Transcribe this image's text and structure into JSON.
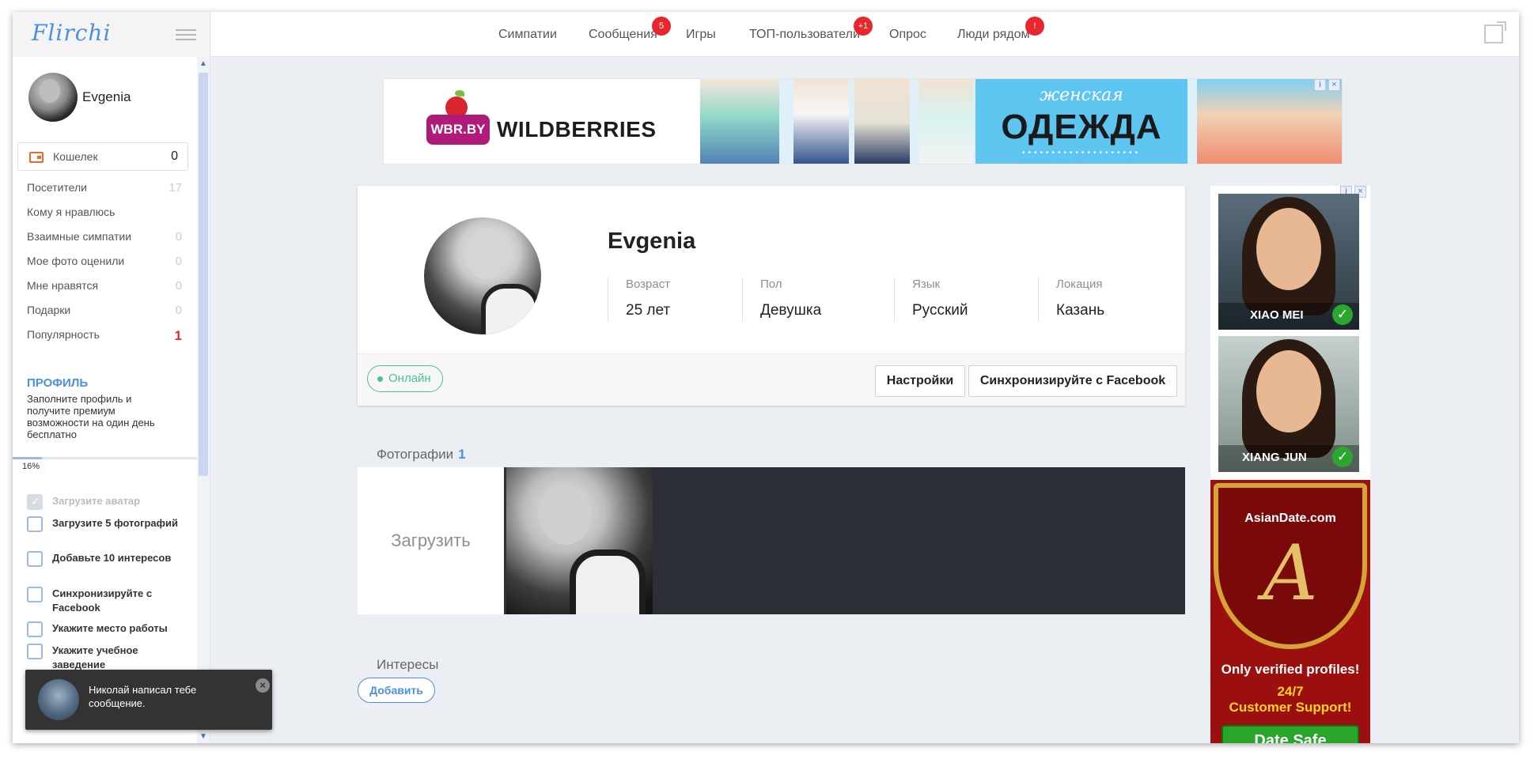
{
  "app": {
    "logo": "Flirchi"
  },
  "nav": {
    "items": [
      {
        "label": "Симпатии",
        "badge": ""
      },
      {
        "label": "Сообщения",
        "badge": "5"
      },
      {
        "label": "Игры",
        "badge": ""
      },
      {
        "label": "ТОП-пользователи",
        "badge": "+1"
      },
      {
        "label": "Опрос",
        "badge": ""
      },
      {
        "label": "Люди рядом",
        "badge": "!"
      }
    ]
  },
  "sidebar": {
    "user_name": "Evgenia",
    "wallet": {
      "label": "Кошелек",
      "value": "0"
    },
    "menu": [
      {
        "label": "Посетители",
        "count": "17"
      },
      {
        "label": "Кому я нравлюсь",
        "count": ""
      },
      {
        "label": "Взаимные симпатии",
        "count": "0"
      },
      {
        "label": "Мое фото оценили",
        "count": "0"
      },
      {
        "label": "Мне нравятся",
        "count": "0"
      },
      {
        "label": "Подарки",
        "count": "0"
      },
      {
        "label": "Популярность",
        "count": "1"
      }
    ],
    "profile": {
      "heading": "ПРОФИЛЬ",
      "description": "Заполните профиль и получите премиум возможности на один день бесплатно",
      "progress_percent": 16,
      "progress_text": "16%"
    },
    "tasks": [
      {
        "label": "Загрузите аватар",
        "done": true
      },
      {
        "label": "Загрузите 5 фотографий",
        "done": false
      },
      {
        "label": "Добавьте 10 интересов",
        "done": false
      },
      {
        "label": "Синхронизируйте с Facebook",
        "done": false
      },
      {
        "label": "Укажите место работы",
        "done": false
      },
      {
        "label": "Укажите учебное заведение",
        "done": false
      }
    ]
  },
  "notification": {
    "text": "Николай написал тебе сообщение."
  },
  "ad_top": {
    "logo_text": "WBR.BY",
    "brand": "WILDBERRIES",
    "tagline_top": "женская",
    "tagline_main": "ОДЕЖДА"
  },
  "profile_card": {
    "name": "Evgenia",
    "stats": [
      {
        "label": "Возраст",
        "value": "25 лет"
      },
      {
        "label": "Пол",
        "value": "Девушка"
      },
      {
        "label": "Язык",
        "value": "Русский"
      },
      {
        "label": "Локация",
        "value": "Казань"
      }
    ],
    "status": "Онлайн",
    "settings_button": "Настройки",
    "facebook_button": "Синхронизируйте с Facebook"
  },
  "photos": {
    "heading": "Фотографии",
    "count": "1",
    "upload_label": "Загрузить"
  },
  "interests": {
    "heading": "Интересы",
    "add_button": "Добавить"
  },
  "ad_side": {
    "profiles": [
      {
        "name": "XIAO MEI"
      },
      {
        "name": "XIANG JUN"
      }
    ],
    "site": "AsianDate.com",
    "verified": "Only verified profiles!",
    "support_line1": "24/7",
    "support_line2": "Customer Support!",
    "button": "Date Safe"
  },
  "colors": {
    "accent": "#4a90e2",
    "badge": "#e8262e",
    "online": "#4cc28e",
    "background": "#ebeef2"
  }
}
